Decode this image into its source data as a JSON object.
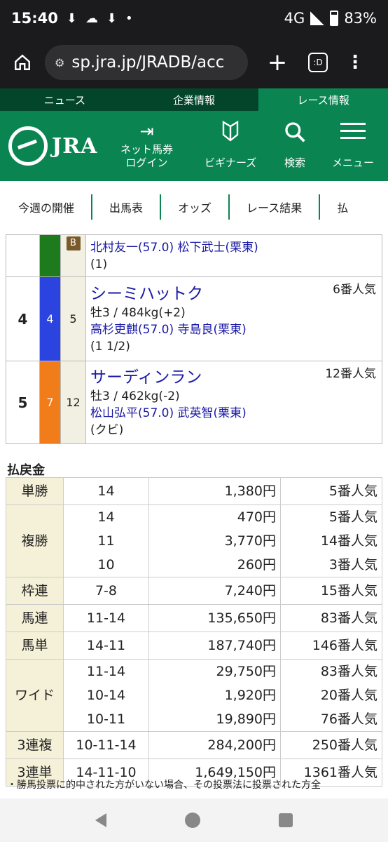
{
  "status": {
    "time": "15:40",
    "network": "4G",
    "battery": "83%"
  },
  "browser": {
    "url": "sp.jra.jp/JRADB/acc",
    "tab_label": ":D"
  },
  "topnav": [
    "ニュース",
    "企業情報",
    "レース情報"
  ],
  "header": {
    "logo": "JRA",
    "login_l1": "ネット馬券",
    "login_l2": "ログイン",
    "beginners": "ビギナーズ",
    "search": "検索",
    "menu": "メニュー"
  },
  "subnav": [
    "今週の開催",
    "出馬表",
    "オッズ",
    "レース結果",
    "払"
  ],
  "results": [
    {
      "rank": "",
      "waku": "",
      "waku_color": "#1d7a1d",
      "umaban": "",
      "blinker": "B",
      "name": "",
      "popularity": "",
      "details": "",
      "jockey": "北村友一(57.0)",
      "trainer": "松下武士(栗東)",
      "margin": "(1)"
    },
    {
      "rank": "4",
      "waku": "4",
      "waku_color": "#2b44e0",
      "umaban": "5",
      "blinker": "",
      "name": "シーミハットク",
      "popularity": "6番人気",
      "details": "牡3 / 484kg(+2)",
      "jockey": "高杉吏麒(57.0)",
      "trainer": "寺島良(栗東)",
      "margin": "(1 1/2)"
    },
    {
      "rank": "5",
      "waku": "7",
      "waku_color": "#f07c1a",
      "umaban": "12",
      "blinker": "",
      "name": "サーディンラン",
      "popularity": "12番人気",
      "details": "牡3 / 462kg(-2)",
      "jockey": "松山弘平(57.0)",
      "trainer": "武英智(栗東)",
      "margin": "(クビ)"
    }
  ],
  "payout_title": "払戻金",
  "payouts": [
    {
      "type": "単勝",
      "rows": [
        {
          "num": "14",
          "amt": "1,380円",
          "pop": "5番人気"
        }
      ]
    },
    {
      "type": "複勝",
      "rows": [
        {
          "num": "14",
          "amt": "470円",
          "pop": "5番人気"
        },
        {
          "num": "11",
          "amt": "3,770円",
          "pop": "14番人気"
        },
        {
          "num": "10",
          "amt": "260円",
          "pop": "3番人気"
        }
      ]
    },
    {
      "type": "枠連",
      "rows": [
        {
          "num": "7-8",
          "amt": "7,240円",
          "pop": "15番人気"
        }
      ]
    },
    {
      "type": "馬連",
      "rows": [
        {
          "num": "11-14",
          "amt": "135,650円",
          "pop": "83番人気"
        }
      ]
    },
    {
      "type": "馬単",
      "rows": [
        {
          "num": "14-11",
          "amt": "187,740円",
          "pop": "146番人気"
        }
      ]
    },
    {
      "type": "ワイド",
      "rows": [
        {
          "num": "11-14",
          "amt": "29,750円",
          "pop": "83番人気"
        },
        {
          "num": "10-14",
          "amt": "1,920円",
          "pop": "20番人気"
        },
        {
          "num": "10-11",
          "amt": "19,890円",
          "pop": "76番人気"
        }
      ]
    },
    {
      "type": "3連複",
      "rows": [
        {
          "num": "10-11-14",
          "amt": "284,200円",
          "pop": "250番人気"
        }
      ]
    },
    {
      "type": "3連単",
      "rows": [
        {
          "num": "14-11-10",
          "amt": "1,649,150円",
          "pop": "1361番人気"
        }
      ]
    }
  ],
  "note": "・勝馬投票に的中された方がいない場合、その投票法に投票された方全"
}
